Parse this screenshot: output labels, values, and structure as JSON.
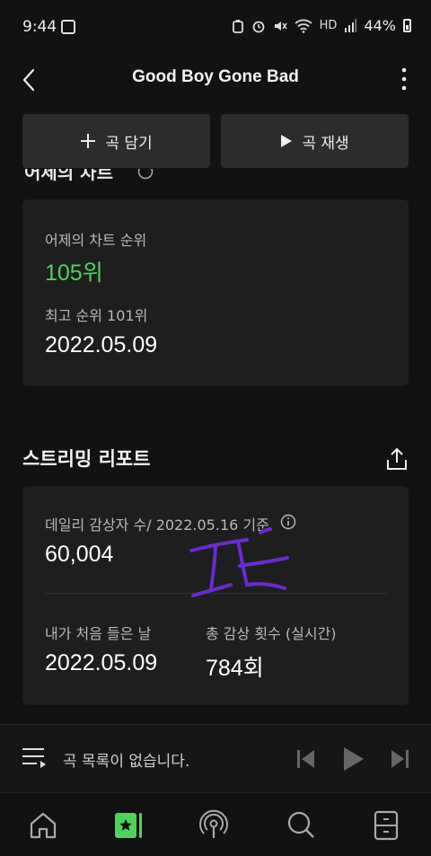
{
  "status": {
    "time": "9:44",
    "hd_label": "HD",
    "battery": "44%"
  },
  "header": {
    "title": "Good Boy Gone Bad"
  },
  "actions": {
    "add_label": "곡 담기",
    "play_label": "곡 재생"
  },
  "chart_card": {
    "heading_partial": "어제의 차트",
    "yesterday_label": "어제의 차트 순위",
    "yesterday_rank": "105위",
    "best_label": "최고 순위 101위",
    "best_date": "2022.05.09"
  },
  "report": {
    "title": "스트리밍 리포트",
    "daily_label": "데일리 감상자 수/ 2022.05.16 기준",
    "daily_value": "60,004",
    "first_listen_label": "내가 처음 들은 날",
    "first_listen_value": "2022.05.09",
    "total_label": "총 감상 횟수 (실시간)",
    "total_value": "784회"
  },
  "player": {
    "text": "곡 목록이 없습니다."
  },
  "colors": {
    "accent_green": "#4ed35c",
    "background": "#121212",
    "card": "#1e1e1e",
    "scribble": "#6a2bd0"
  },
  "icons": [
    "back-icon",
    "more-icon",
    "plus-icon",
    "play-icon",
    "info-icon",
    "share-icon",
    "playlist-icon",
    "prev-icon",
    "next-icon",
    "home-icon",
    "my-music-icon",
    "podcast-icon",
    "search-icon",
    "storage-icon"
  ]
}
